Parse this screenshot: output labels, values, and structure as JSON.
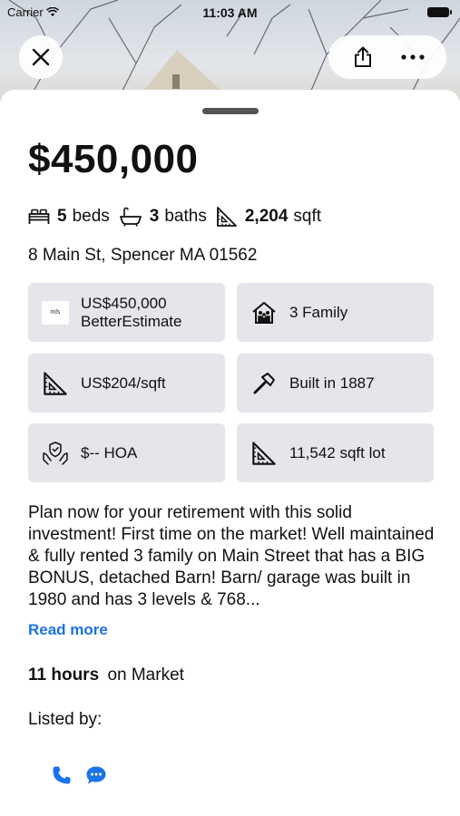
{
  "status_bar": {
    "carrier": "Carrier",
    "time": "11:03 AM"
  },
  "header": {
    "close_icon": "close-icon",
    "share_icon": "share-icon",
    "more_icon": "more-icon"
  },
  "listing": {
    "price": "$450,000",
    "beds_count": "5",
    "beds_label": "beds",
    "baths_count": "3",
    "baths_label": "baths",
    "sqft_count": "2,204",
    "sqft_label": "sqft",
    "address": "8 Main St, Spencer MA 01562"
  },
  "tiles": {
    "estimate_value": "US$450,000",
    "estimate_label": "BetterEstimate",
    "estimate_logo_text": "mls",
    "property_type": "3 Family",
    "price_per_sqft": "US$204/sqft",
    "year_built": "Built in 1887",
    "hoa": "$-- HOA",
    "lot_size": "11,542 sqft lot"
  },
  "description": {
    "text": "Plan now for your retirement with this solid investment! First time on the market! Well maintained & fully rented 3 family on Main Street that has a  BIG BONUS, detached Barn!  Barn/ garage was built in 1980 and has 3 levels & 768...",
    "read_more": "Read more"
  },
  "market": {
    "time": "11 hours",
    "label": "on Market"
  },
  "listed_by": {
    "label": "Listed by:"
  },
  "colors": {
    "accent": "#1a73e8",
    "tile_bg": "#e5e5ea"
  }
}
